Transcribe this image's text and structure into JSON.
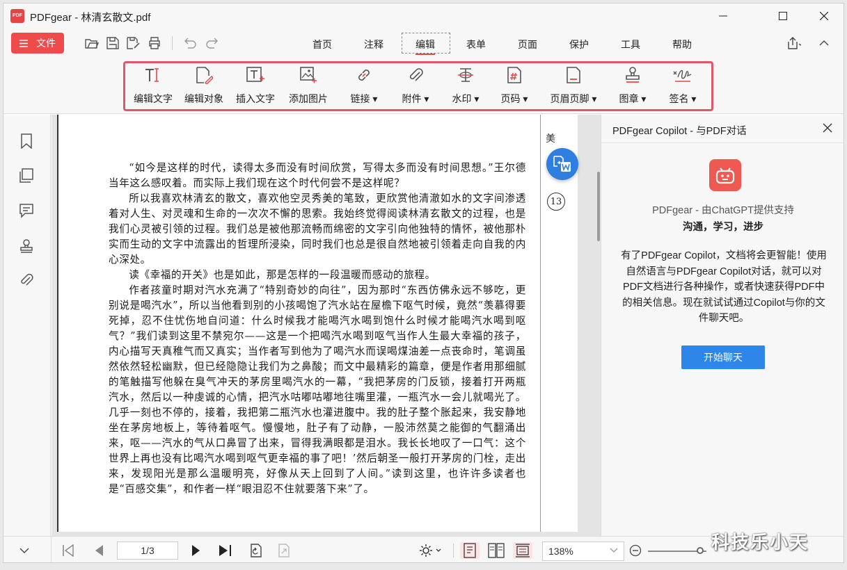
{
  "window": {
    "title": "PDFgear - 林清玄散文.pdf",
    "logo_text": "PDF"
  },
  "menubar": {
    "file_label": "文件",
    "tabs": [
      {
        "label": "首页"
      },
      {
        "label": "注释"
      },
      {
        "label": "编辑"
      },
      {
        "label": "表单"
      },
      {
        "label": "页面"
      },
      {
        "label": "保护"
      },
      {
        "label": "工具"
      },
      {
        "label": "帮助"
      }
    ],
    "active_tab": "编辑"
  },
  "ribbon": {
    "tools": [
      {
        "label": "编辑文字",
        "icon": "edit-text-icon"
      },
      {
        "label": "编辑对象",
        "icon": "edit-object-icon"
      },
      {
        "label": "插入文字",
        "icon": "insert-text-icon"
      },
      {
        "label": "添加图片",
        "icon": "add-image-icon"
      },
      {
        "label": "链接",
        "icon": "link-icon"
      },
      {
        "label": "附件",
        "icon": "attachment-icon"
      },
      {
        "label": "水印",
        "icon": "watermark-icon"
      },
      {
        "label": "页码",
        "icon": "page-number-icon"
      },
      {
        "label": "页眉页脚",
        "icon": "header-footer-icon"
      },
      {
        "label": "图章",
        "icon": "stamp-icon"
      },
      {
        "label": "签名",
        "icon": "signature-icon"
      }
    ],
    "dropdown_mark": "▾"
  },
  "document": {
    "paragraphs": [
      "“如今是这样的时代，读得太多而没有时间欣赏，写得太多而没有时间思想。”王尔德当年这么感叹着。而实际上我们现在这个时代何尝不是这样呢？",
      "所以我喜欢林清玄的散文，喜欢他空灵秀美的笔致，更欣赏他清澈如水的文字间渗透着对人生、对灵魂和生命的一次次不懈的思索。我始终觉得阅读林清玄散文的过程，也是我们心灵被引领的过程。我们总是被他那流畅而绵密的文字引向他独特的情怀，被他那朴实而生动的文字中流露出的哲理所浸染，同时我们也总是很自然地被引领着走向自我的内心深处。",
      "读《幸福的开关》也是如此，那是怎样的一段温暖而感动的旅程。",
      "作者孩童时期对汽水充满了“特别奇妙的向往”，因为那时“东西仿佛永远不够吃，更别说是喝汽水”，所以当他看到别的小孩喝饱了汽水站在屋檐下呕气时候，竟然“羡慕得要死掉，忍不住忧伤地自问道：什么时候我才能喝汽水喝到饱什么时候才能喝汽水喝到呕气？”我们读到这里不禁宛尔——这是一个把喝汽水喝到呕气当作人生最大幸福的孩子，内心描写天真稚气而又真实；当作者写到他为了喝汽水而误喝煤油差一点丧命时，笔调虽然依然轻松幽默，但已经隐隐让我们为之鼻酸；而文中最精彩的篇章，便是作者用那细腻的笔触描写他躲在臭气冲天的茅房里喝汽水的一幕，“我把茅房的门反锁，接着打开两瓶汽水，然后以一种虔诚的心情，把汽水咕嘟咕嘟地往嘴里灌，一瓶汽水一会儿就喝光了。几乎一刻也不停的，接着，我把第二瓶汽水也灌进腹中。我的肚子整个胀起来，我安静地坐在茅房地板上，等待着呕气。慢慢地，肚子有了动静，一股沛然莫之能御的气翻涌出来，呕——汽水的气从口鼻冒了出来，冒得我满眼都是泪水。我长长地叹了一口气：这个世界上再也没有比喝汽水喝到呕气更幸福的事了吧！’然后朝圣一般打开茅房的门栓，走出来，发现阳光是那么温暖明亮，好像从天上回到了人间。”读到这里，也许许多读者也是“百感交集”，和作者一样“眼泪忍不住就要落下来”了。"
    ],
    "next_page_char": "美",
    "page_number": "13"
  },
  "copilot": {
    "title": "PDFgear Copilot - 与PDF对话",
    "subtitle": "PDFgear - 由ChatGPT提供支持",
    "tagline": "沟通，学习，进步",
    "description": "有了PDFgear Copilot，文档将会更智能！使用自然语言与PDFgear Copilot对话，就可以对PDF文档进行各种操作，或者快速获得PDF中的相关信息。现在就试试通过Copilot与你的文件聊天吧。",
    "button_label": "开始聊天"
  },
  "statusbar": {
    "page_indicator": "1/3",
    "zoom_value": "138%",
    "zoom_slider_fraction": 0.9
  },
  "watermark": "科技乐小天",
  "colors": {
    "accent_red": "#ef4b4b",
    "ribbon_highlight": "#e0566b",
    "primary_blue": "#2e86e8"
  }
}
